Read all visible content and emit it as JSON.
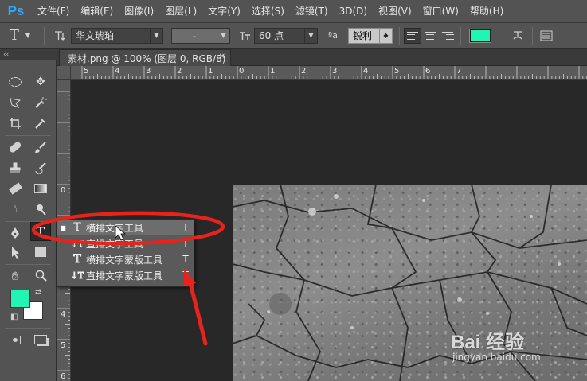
{
  "app": {
    "logo": "Ps",
    "menu": [
      "文件(F)",
      "编辑(E)",
      "图像(I)",
      "图层(L)",
      "文字(Y)",
      "选择(S)",
      "滤镜(T)",
      "3D(D)",
      "视图(V)",
      "窗口(W)",
      "帮助(H)"
    ]
  },
  "options_bar": {
    "font_family": "华文琥珀",
    "font_style": "-",
    "font_size": "60 点",
    "antialias": "锐利",
    "aa_label": "ªa",
    "text_color": "#20f5b4"
  },
  "panel": {
    "collapse_label": "‹‹"
  },
  "document": {
    "tab_title": "素材.png @ 100% (图层 0, RGB/8)",
    "close_label": "✕"
  },
  "rulers": {
    "horizontal": [
      "5",
      "4",
      "3",
      "2",
      "1",
      "0",
      "1",
      "2",
      "3",
      "4",
      "5",
      "6",
      "7"
    ],
    "vertical": [
      "0",
      "1",
      "2",
      "3",
      "4",
      "5",
      "6"
    ]
  },
  "toolbar": {
    "foreground_color": "#20f5b4",
    "background_color": "#ffffff"
  },
  "flyout": {
    "items": [
      {
        "label": "横排文字工具",
        "key": "T",
        "icon": "T",
        "selected": true
      },
      {
        "label": "直排文字工具",
        "key": "T",
        "icon": "↓T",
        "selected": false
      },
      {
        "label": "横排文字蒙版工具",
        "key": "T",
        "icon": "T",
        "selected": false
      },
      {
        "label": "直排文字蒙版工具",
        "key": "T",
        "icon": "↓T",
        "selected": false
      }
    ]
  },
  "watermark": {
    "brand": "Bai 经验",
    "url": "jingyan.baidu.com"
  },
  "annotation_color": "#e8231c"
}
